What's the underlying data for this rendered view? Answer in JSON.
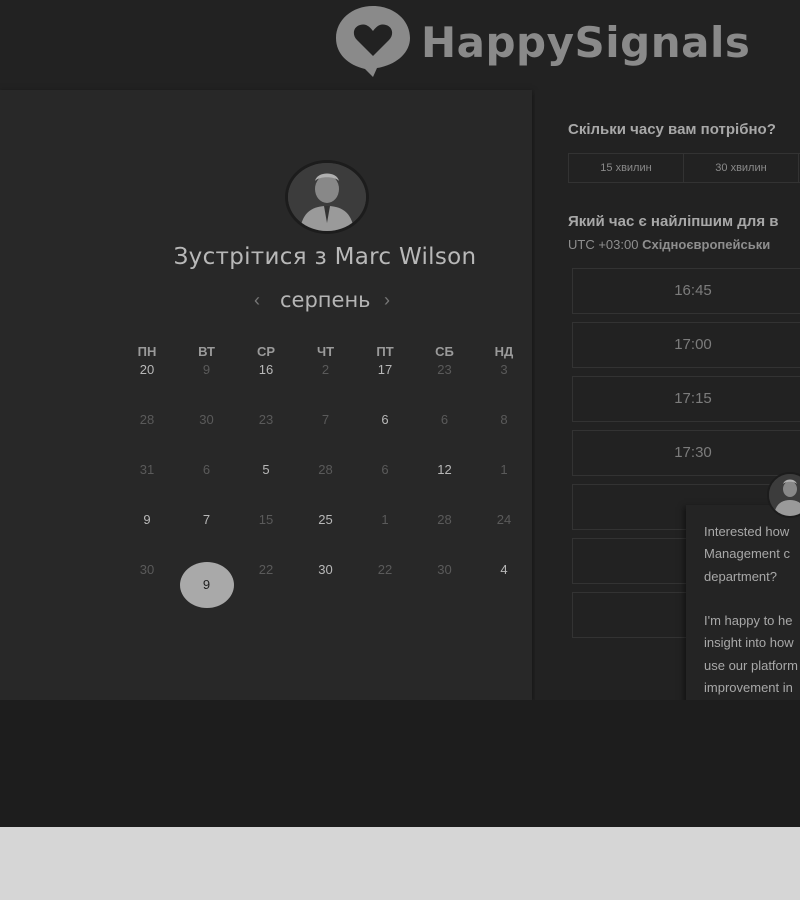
{
  "brand": {
    "name": "HappySignals",
    "logo_icon": "heart-speech-bubble-icon"
  },
  "booking": {
    "title_prefix": "Зустрітися з",
    "host_name": "Marc Wilson",
    "avatar_icon": "host-avatar",
    "month": "серпень",
    "prev_icon": "chevron-left-icon",
    "next_icon": "chevron-right-icon",
    "weekdays": [
      "ПН",
      "ВТ",
      "СР",
      "ЧТ",
      "ПТ",
      "СБ",
      "НД"
    ],
    "weeks": [
      [
        {
          "d": "20",
          "s": "active"
        },
        {
          "d": "9",
          "s": "dim"
        },
        {
          "d": "16",
          "s": "active"
        },
        {
          "d": "2",
          "s": "dim"
        },
        {
          "d": "17",
          "s": "active"
        },
        {
          "d": "23",
          "s": "dim"
        },
        {
          "d": "3",
          "s": "dim"
        }
      ],
      [
        {
          "d": "28",
          "s": "dim"
        },
        {
          "d": "30",
          "s": "dim"
        },
        {
          "d": "23",
          "s": "dim"
        },
        {
          "d": "7",
          "s": "dim"
        },
        {
          "d": "6",
          "s": "active"
        },
        {
          "d": "6",
          "s": "dim"
        },
        {
          "d": "8",
          "s": "dim"
        }
      ],
      [
        {
          "d": "31",
          "s": "dim"
        },
        {
          "d": "6",
          "s": "dim"
        },
        {
          "d": "5",
          "s": "active"
        },
        {
          "d": "28",
          "s": "dim"
        },
        {
          "d": "6",
          "s": "dim"
        },
        {
          "d": "12",
          "s": "active"
        },
        {
          "d": "1",
          "s": "dim"
        }
      ],
      [
        {
          "d": "9",
          "s": "active"
        },
        {
          "d": "7",
          "s": "active"
        },
        {
          "d": "15",
          "s": "dim"
        },
        {
          "d": "25",
          "s": "active"
        },
        {
          "d": "1",
          "s": "dim"
        },
        {
          "d": "28",
          "s": "dim"
        },
        {
          "d": "24",
          "s": "dim"
        }
      ],
      [
        {
          "d": "30",
          "s": "dim"
        },
        {
          "d": "9",
          "s": "selected"
        },
        {
          "d": "22",
          "s": "dim"
        },
        {
          "d": "30",
          "s": "active"
        },
        {
          "d": "22",
          "s": "dim"
        },
        {
          "d": "30",
          "s": "dim"
        },
        {
          "d": "4",
          "s": "active"
        }
      ]
    ]
  },
  "schedule": {
    "duration_question": "Скільки часу вам потрібно?",
    "durations": [
      "15 хвилин",
      "30 хвилин",
      ""
    ],
    "time_question": "Який час є найліпшим для в",
    "timezone_offset": "UTC +03:00",
    "timezone_name": "Східноєвропейськи",
    "slots": [
      "16:45",
      "17:00",
      "17:15",
      "17:30",
      "",
      "",
      ""
    ]
  },
  "chat": {
    "avatar_icon": "chat-avatar",
    "message_1": "Interested how Management c department?",
    "message_2": "I'm happy to he insight into how use our platform improvement in productivity."
  },
  "colors": {
    "background": "#222222",
    "panel": "#282828",
    "selected_day": "#a9a9a9",
    "footer": "#d6d6d6"
  }
}
